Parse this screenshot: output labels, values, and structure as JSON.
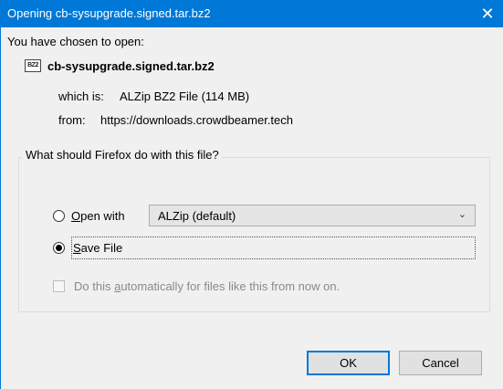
{
  "window": {
    "title": "Opening cb-sysupgrade.signed.tar.bz2",
    "close_glyph": "✕"
  },
  "intro": "You have chosen to open:",
  "file": {
    "icon": "archive-file-icon",
    "icon_text": "BZ2",
    "name": "cb-sysupgrade.signed.tar.bz2",
    "type_label": "which is:",
    "type_value": "ALZip BZ2 File (114 MB)",
    "from_label": "from:",
    "from_value": "https://downloads.crowdbeamer.tech"
  },
  "action_group": {
    "legend": "What should Firefox do with this file?",
    "open_with": {
      "label": "Open with",
      "checked": false,
      "app": "ALZip (default)"
    },
    "save_file": {
      "label": "Save File",
      "checked": true
    },
    "auto": {
      "label": "Do this automatically for files like this from now on.",
      "checked": false,
      "disabled": true
    }
  },
  "buttons": {
    "ok": "OK",
    "cancel": "Cancel"
  },
  "colors": {
    "titlebar": "#0078d7",
    "dialog_bg": "#f0f0f0",
    "default_button_border": "#0078d7"
  }
}
